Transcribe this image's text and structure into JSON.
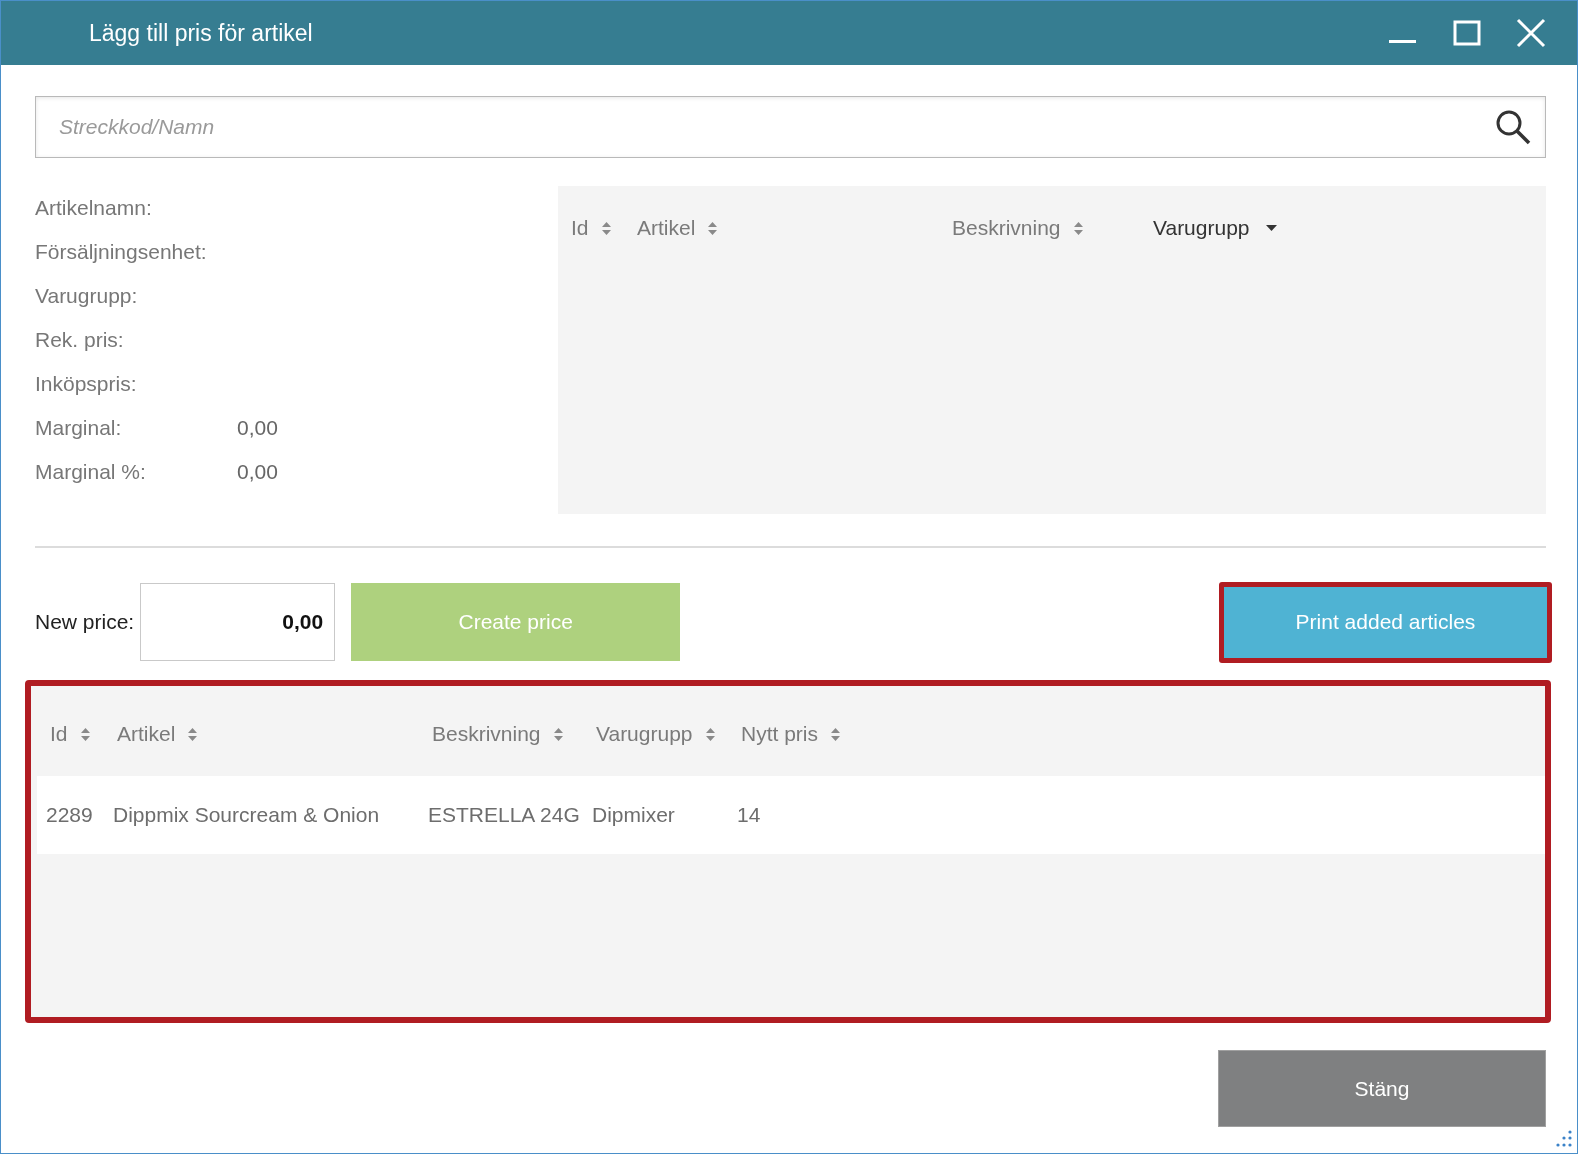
{
  "window": {
    "title": "Lägg till pris för artikel"
  },
  "search": {
    "placeholder": "Streckkod/Namn"
  },
  "details": [
    {
      "label": "Artikelnamn:"
    },
    {
      "label": "Försäljningsenhet:"
    },
    {
      "label": "Varugrupp:"
    },
    {
      "label": "Rek. pris:"
    },
    {
      "label": "Inköpspris:"
    },
    {
      "label": "Marginal:",
      "value": "0,00"
    },
    {
      "label": "Marginal %:",
      "value": "0,00"
    }
  ],
  "article_grid": {
    "columns": [
      {
        "label": "Id",
        "sorted": false
      },
      {
        "label": "Artikel",
        "sorted": false
      },
      {
        "label": "Beskrivning",
        "sorted": false
      },
      {
        "label": "Varugrupp",
        "sorted": true
      }
    ]
  },
  "new_price": {
    "label": "New price:",
    "value": "0,00"
  },
  "create_button": {
    "label": "Create price"
  },
  "print_button": {
    "label": "Print added articles",
    "highlighted": true
  },
  "added_grid": {
    "highlighted": true,
    "columns": [
      {
        "label": "Id",
        "sorted": false
      },
      {
        "label": "Artikel",
        "sorted": false
      },
      {
        "label": "Beskrivning",
        "sorted": false
      },
      {
        "label": "Varugrupp",
        "sorted": false
      },
      {
        "label": "Nytt pris",
        "sorted": false
      }
    ],
    "rows": [
      [
        "2289",
        "Dippmix Sourcream & Onion",
        "ESTRELLA 24G",
        "Dipmixer",
        "14"
      ]
    ]
  },
  "close_button": {
    "label": "Stäng"
  }
}
